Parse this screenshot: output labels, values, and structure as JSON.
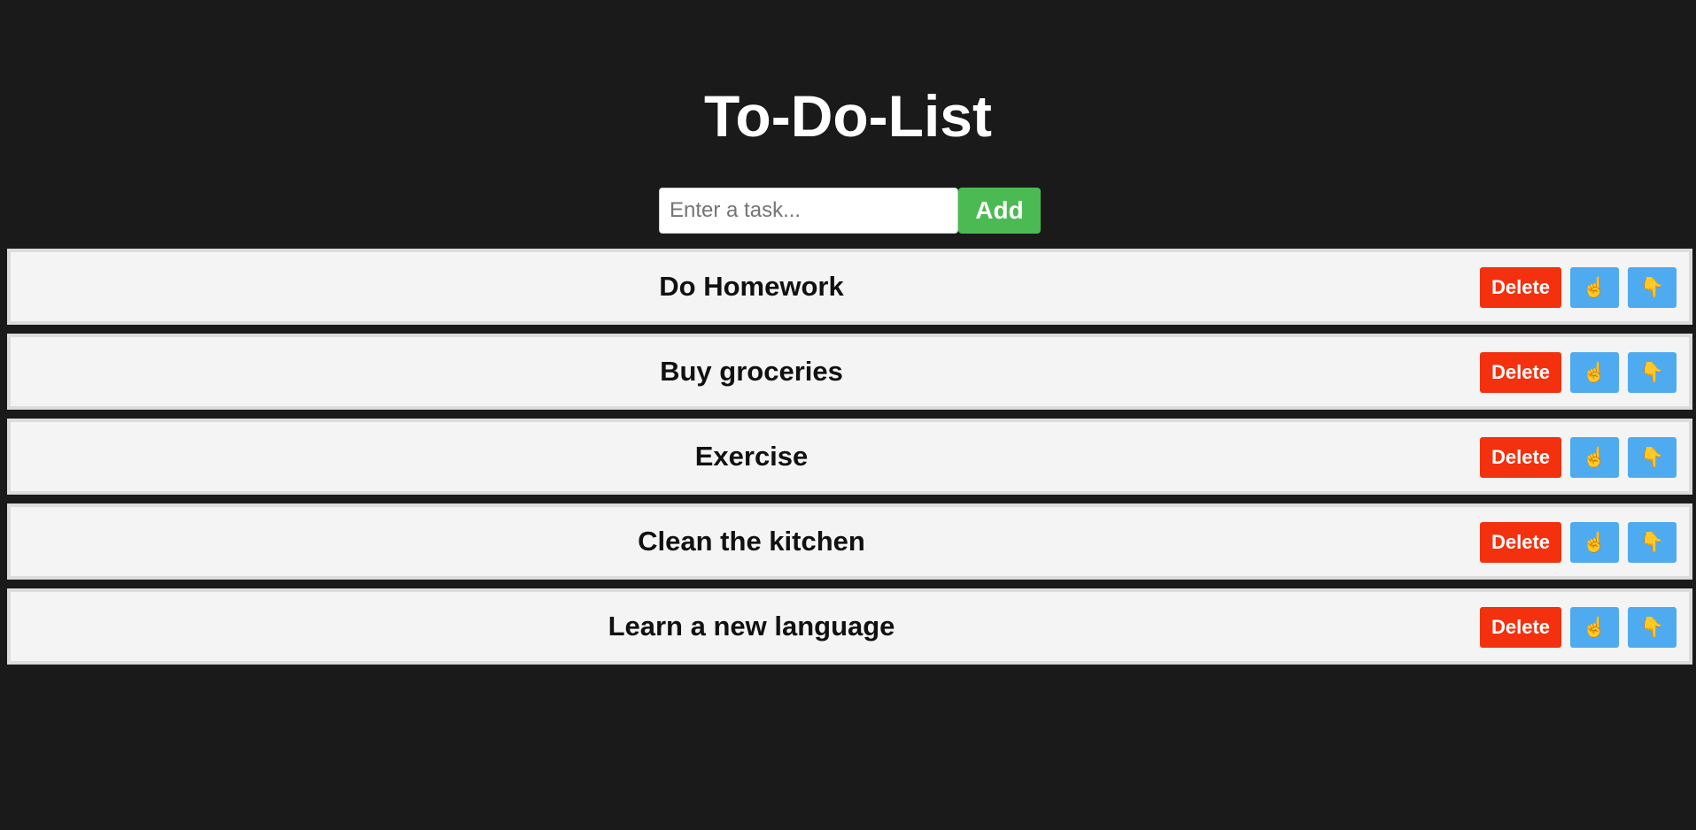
{
  "app": {
    "title": "To-Do-List"
  },
  "add_form": {
    "placeholder": "Enter a task...",
    "value": "",
    "add_label": "Add"
  },
  "tasks": [
    {
      "text": "Do Homework",
      "delete_label": "Delete",
      "up_icon": "☝",
      "down_icon": "👇"
    },
    {
      "text": "Buy groceries",
      "delete_label": "Delete",
      "up_icon": "☝",
      "down_icon": "👇"
    },
    {
      "text": "Exercise",
      "delete_label": "Delete",
      "up_icon": "☝",
      "down_icon": "👇"
    },
    {
      "text": "Clean the kitchen",
      "delete_label": "Delete",
      "up_icon": "☝",
      "down_icon": "👇"
    },
    {
      "text": "Learn a new language",
      "delete_label": "Delete",
      "up_icon": "☝",
      "down_icon": "👇"
    }
  ],
  "colors": {
    "background": "#1a1a1a",
    "add_button": "#4cba52",
    "delete_button": "#f3310f",
    "move_button": "#4fabf0",
    "item_background": "#f4f4f4"
  }
}
